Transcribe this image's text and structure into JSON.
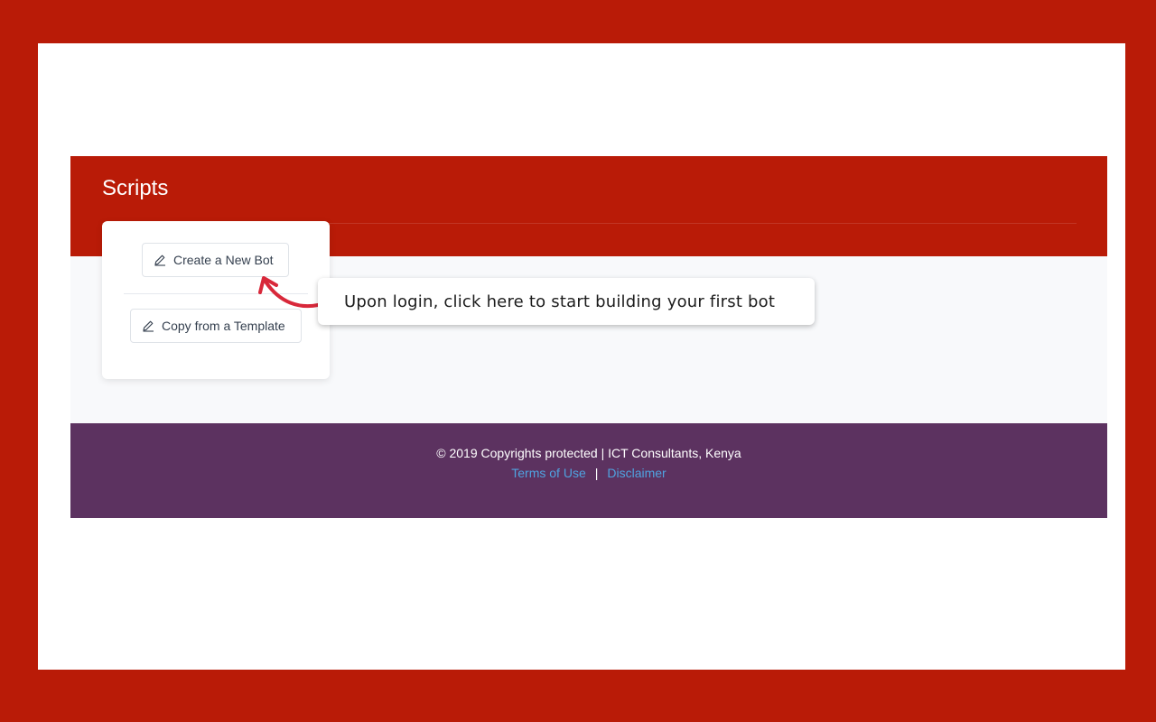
{
  "header": {
    "title": "Scripts"
  },
  "card": {
    "create_label": "Create a New Bot",
    "template_label": "Copy from a Template",
    "create_icon": "pencil-icon",
    "template_icon": "pencil-icon"
  },
  "callout": {
    "text": "Upon login, click here to start building your first bot"
  },
  "footer": {
    "copyright": "© 2019 Copyrights protected | ICT Consultants, Kenya",
    "terms_label": "Terms of Use",
    "separator": "|",
    "disclaimer_label": "Disclaimer"
  },
  "colors": {
    "brand_red": "#b91b07",
    "footer_purple": "#5c3260",
    "link_blue": "#4fa3e0",
    "arrow_red": "#d8283a"
  }
}
